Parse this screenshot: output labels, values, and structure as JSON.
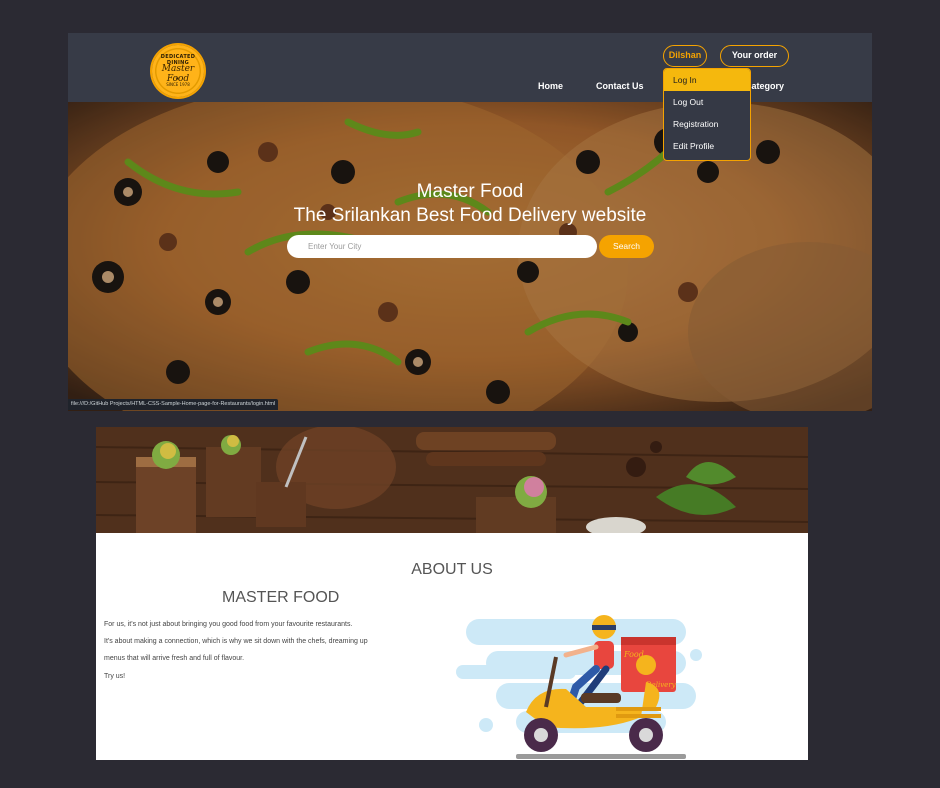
{
  "top": {
    "logo": {
      "top_text": "DEDICATED DINING",
      "name": "Master Food",
      "bottom_text": "SINCE 1978"
    },
    "nav": {
      "user": "Dilshan",
      "order": "Your order",
      "home": "Home",
      "contact": "Contact Us",
      "category": "Category"
    },
    "dropdown": {
      "items": [
        "Log In",
        "Log Out",
        "Registration",
        "Edit Profile"
      ]
    },
    "hero": {
      "title": "Master Food",
      "subtitle": "The Srilankan Best Food Delivery website",
      "search_placeholder": "Enter Your City",
      "search_button": "Search"
    },
    "status_url": "file:///D:/GitHub Projects/HTML-CSS-Sample-Home-page-for-Restaurants/login.html"
  },
  "bottom": {
    "about_title": "ABOUT US",
    "brand": "MASTER FOOD",
    "paragraphs": [
      "For us, it's not just about bringing you good food from your favourite restaurants.",
      "It's about making a connection, which is why we sit down with the chefs, dreaming up",
      "menus that will arrive fresh and full of flavour.",
      "Try us!"
    ],
    "illustration": {
      "box_text_top": "Food",
      "box_text_bottom": "Delivery"
    }
  },
  "colors": {
    "accent": "#f5a300",
    "navbar": "#373b47",
    "background": "#2b2a33"
  },
  "icons": {
    "logo": "master-food-logo-badge",
    "illustration": "scooter-delivery-icon"
  }
}
